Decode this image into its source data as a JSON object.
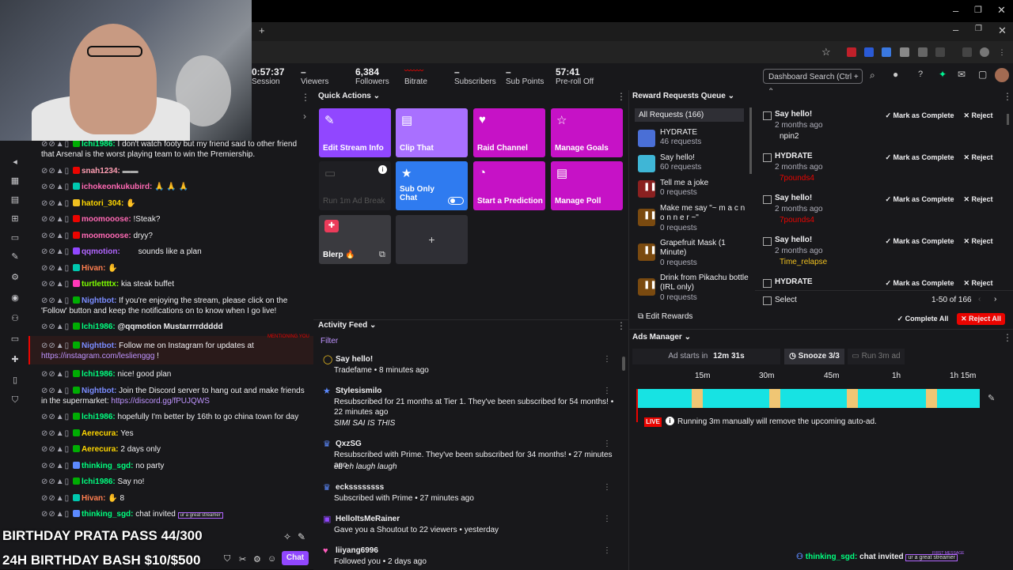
{
  "browser": {
    "minimize": "–",
    "restore": "❐",
    "close": "✕",
    "new_tab": "+"
  },
  "stats": {
    "session": {
      "value": "0:57:37",
      "label": "Session"
    },
    "viewers": {
      "value": "–",
      "label": "Viewers"
    },
    "followers": {
      "value": "6,384",
      "label": "Followers"
    },
    "bitrate": {
      "value": "",
      "label": "Bitrate"
    },
    "subscribers": {
      "value": "–",
      "label": "Subscribers"
    },
    "sub_points": {
      "value": "–",
      "label": "Sub Points"
    },
    "preroll": {
      "value": "57:41",
      "label": "Pre-roll Off"
    },
    "search_placeholder": "Dashboard Search (Ctrl + /)"
  },
  "chat": {
    "lines": [
      {
        "name": "lchi1986:",
        "color": "#00ff7f",
        "text": "I don't watch footy but my friend said to other friend that Arsenal is the worst playing team to win the Premiership."
      },
      {
        "name": "snah1234:",
        "color": "#ff9eb3",
        "text": ""
      },
      {
        "name": "ichokeonkukubird:",
        "color": "#ff69b4",
        "text": ""
      },
      {
        "name": "hatori_304:",
        "color": "#ffd700",
        "text": ""
      },
      {
        "name": "moomooose:",
        "color": "#ff69b4",
        "text": "!Steak?"
      },
      {
        "name": "moomooose:",
        "color": "#ff69b4",
        "text": "dryy?"
      },
      {
        "name": "qqmotion:",
        "color": "#b266ff",
        "text": "sounds like a plan"
      },
      {
        "name": "Hivan:",
        "color": "#ff7f50",
        "text": ""
      },
      {
        "name": "turtlettttx:",
        "color": "#7fff00",
        "text": "kia steak buffet"
      },
      {
        "name": "Nightbot:",
        "color": "#7a8cff",
        "text": "If you're enjoying the stream, please click on the 'Follow' button and keep the notifications on to know when I go live!"
      },
      {
        "name": "lchi1986:",
        "color": "#00ff7f",
        "text": "@qqmotion Mustarrrrddddd"
      },
      {
        "name": "Nightbot:",
        "color": "#7a8cff",
        "text": "Follow me on Instagram for updates at",
        "link": "https://instagram.com/leslienggg",
        "after": " !"
      },
      {
        "name": "lchi1986:",
        "color": "#00ff7f",
        "text": "nice! good plan"
      },
      {
        "name": "Nightbot:",
        "color": "#7a8cff",
        "text": "Join the Discord server to hang out and make friends in the supermarket:",
        "link": "https://discord.gg/fPUJQWS",
        "after": ""
      },
      {
        "name": "lchi1986:",
        "color": "#00ff7f",
        "text": "hopefully I'm better by 16th to go china town for day"
      },
      {
        "name": "Aerecura:",
        "color": "#ffd700",
        "text": "Yes"
      },
      {
        "name": "Aerecura:",
        "color": "#ffd700",
        "text": "2 days only"
      },
      {
        "name": "thinking_sgd:",
        "color": "#00ff7f",
        "text": "no party"
      },
      {
        "name": "lchi1986:",
        "color": "#00ff7f",
        "text": "Say no!"
      },
      {
        "name": "Hivan:",
        "color": "#ff7f50",
        "text": "8"
      },
      {
        "name": "thinking_sgd:",
        "color": "#00ff7f",
        "text": "chat invited"
      }
    ],
    "mentioning_you": "MENTIONING YOU",
    "first_message": "FIRST MESSAGE",
    "great_streamer": "ur a great streamer",
    "chat_button": "Chat"
  },
  "overlay": {
    "line1": "BIRTHDAY PRATA PASS 44/300",
    "line2": "24H BIRTHDAY BASH $10/$500",
    "bottom_name": "thinking_sgd:",
    "bottom_text": "chat invited"
  },
  "quick_actions": {
    "title": "Quick Actions",
    "tiles": [
      {
        "label": "Edit Stream Info",
        "icon": "✎"
      },
      {
        "label": "Clip That",
        "icon": "▤"
      },
      {
        "label": "Raid Channel",
        "icon": "♥"
      },
      {
        "label": "Manage Goals",
        "icon": "☆"
      },
      {
        "label": "Run 1m Ad Break",
        "icon": "▭"
      },
      {
        "label": "Sub Only Chat",
        "icon": "★"
      },
      {
        "label": "Start a Prediction",
        "icon": "◔"
      },
      {
        "label": "Manage Poll",
        "icon": "▤"
      },
      {
        "label": "Blerp 🔥",
        "icon": "✚"
      },
      {
        "label": "+",
        "icon": ""
      }
    ]
  },
  "reward_queue": {
    "title": "Reward Requests Queue",
    "all_requests": "All Requests (166)",
    "rewards": [
      {
        "title": "HYDRATE",
        "count": "46 requests",
        "color": "#4a6fd6"
      },
      {
        "title": "Say hello!",
        "count": "60 requests",
        "color": "#3fb6d6"
      },
      {
        "title": "Tell me a joke",
        "count": "0 requests",
        "color": "#8a2020"
      },
      {
        "title": "Make me say \"~ m a c n o n n e r ~\"",
        "count": "0 requests",
        "color": "#7a4a10"
      },
      {
        "title": "Grapefruit Mask (1 Minute)",
        "count": "0 requests",
        "color": "#7a4a10"
      },
      {
        "title": "Drink from Pikachu bottle (IRL only)",
        "count": "0 requests",
        "color": "#7a4a10"
      }
    ],
    "edit_rewards": "Edit Rewards",
    "requests": [
      {
        "title": "Say hello!",
        "ago": "2 months ago",
        "user": "npin2",
        "user_color": "#efeff1"
      },
      {
        "title": "HYDRATE",
        "ago": "2 months ago",
        "user": "7pounds4",
        "user_color": "#eb0400"
      },
      {
        "title": "Say hello!",
        "ago": "2 months ago",
        "user": "7pounds4",
        "user_color": "#eb0400"
      },
      {
        "title": "Say hello!",
        "ago": "2 months ago",
        "user": "Time_relapse",
        "user_color": "#f0c020"
      },
      {
        "title": "HYDRATE",
        "ago": "",
        "user": "",
        "user_color": "#efeff1"
      }
    ],
    "mark_complete": "Mark as Complete",
    "reject": "Reject",
    "select": "Select",
    "pagination": "1-50 of 166",
    "complete_all": "Complete All",
    "reject_all": "Reject All"
  },
  "activity_feed": {
    "title": "Activity Feed",
    "filter": "Filter",
    "items": [
      {
        "icon": "◯",
        "icon_color": "#f0c020",
        "title": "Say hello!",
        "body": "Tradefame • 8 minutes ago",
        "sub": ""
      },
      {
        "icon": "★",
        "icon_color": "#5c8aff",
        "title": "Stylesismilo",
        "body": "Resubscribed for 21 months at Tier 1. They've been subscribed for 54 months! • 22 minutes ago",
        "sub": "SIMI SAI IS THIS"
      },
      {
        "icon": "♛",
        "icon_color": "#5c8aff",
        "title": "QxzSG",
        "body": "Resubscribed with Prime. They've been subscribed for 34 months! • 27 minutes ago",
        "sub": "eh eh laugh laugh"
      },
      {
        "icon": "♛",
        "icon_color": "#5c8aff",
        "title": "eckssssssss",
        "body": "Subscribed with Prime • 27 minutes ago",
        "sub": ""
      },
      {
        "icon": "▣",
        "icon_color": "#9147ff",
        "title": "HelloItsMeRainer",
        "body": "Gave you a Shoutout to 22 viewers • yesterday",
        "sub": ""
      },
      {
        "icon": "♥",
        "icon_color": "#ff5cbd",
        "title": "liiyang6996",
        "body": "Followed you • 2 days ago",
        "sub": ""
      }
    ]
  },
  "ads_manager": {
    "title": "Ads Manager",
    "ad_starts_label": "Ad starts in",
    "ad_starts_value": "12m 31s",
    "snooze": "Snooze 3/3",
    "run_ad": "Run 3m ad",
    "ticks": [
      "15m",
      "30m",
      "45m",
      "1h",
      "1h 15m"
    ],
    "live": "LIVE",
    "warning": "Running 3m manually will remove the upcoming auto-ad."
  }
}
